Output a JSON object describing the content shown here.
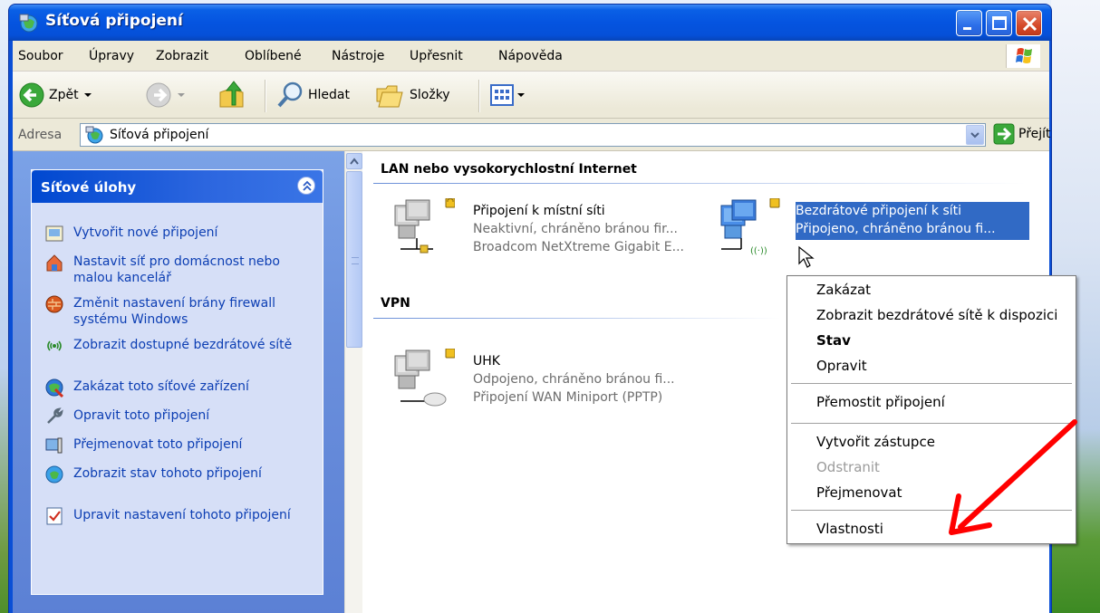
{
  "window": {
    "title": "Síťová připojení"
  },
  "menu": [
    "Soubor",
    "Úpravy",
    "Zobrazit",
    "Oblíbené",
    "Nástroje",
    "Upřesnit",
    "Nápověda"
  ],
  "toolbar": {
    "back_label": "Zpět",
    "search_label": "Hledat",
    "folders_label": "Složky"
  },
  "address": {
    "label": "Adresa",
    "value": "Síťová připojení",
    "go_label": "Přejít"
  },
  "tasks": {
    "title": "Síťové úlohy",
    "items": [
      {
        "label": "Vytvořit nové připojení"
      },
      {
        "label": "Nastavit síť pro domácnost nebo malou kancelář"
      },
      {
        "label": "Změnit nastavení brány firewall systému Windows"
      },
      {
        "label": "Zobrazit dostupné bezdrátové sítě"
      },
      {
        "label": "Zakázat toto síťové zařízení"
      },
      {
        "label": "Opravit toto připojení"
      },
      {
        "label": "Přejmenovat toto připojení"
      },
      {
        "label": "Zobrazit stav tohoto připojení"
      },
      {
        "label": "Upravit nastavení tohoto připojení"
      }
    ]
  },
  "groups": [
    {
      "title": "LAN nebo vysokorychlostní Internet"
    },
    {
      "title": "VPN"
    }
  ],
  "connections": [
    {
      "name": "Připojení k místní síti",
      "status": "Neaktivní, chráněno bránou fir...",
      "device": "Broadcom NetXtreme Gigabit E..."
    },
    {
      "name": "Bezdrátové připojení k síti",
      "status": "Připojeno, chráněno bránou fi...",
      "device": ""
    },
    {
      "name": "UHK",
      "status": "Odpojeno, chráněno bránou fi...",
      "device": "Připojení WAN Miniport (PPTP)"
    }
  ],
  "context_menu": {
    "items": [
      {
        "label": "Zakázat"
      },
      {
        "label": "Zobrazit bezdrátové sítě k dispozici"
      },
      {
        "label": "Stav"
      },
      {
        "label": "Opravit"
      },
      {
        "label": "Přemostit připojení"
      },
      {
        "label": "Vytvořit zástupce"
      },
      {
        "label": "Odstranit"
      },
      {
        "label": "Přejmenovat"
      },
      {
        "label": "Vlastnosti"
      }
    ]
  },
  "colors": {
    "accent": "#0a5be0",
    "selection": "#316ac5",
    "annotation": "#ff0000",
    "link": "#0c3eb3"
  }
}
